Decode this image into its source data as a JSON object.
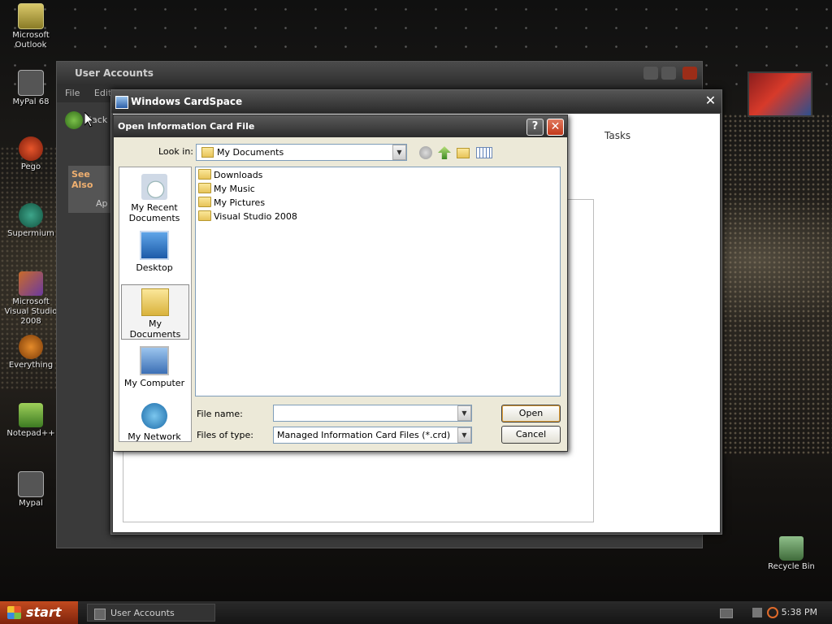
{
  "desktop": {
    "icons": [
      {
        "label": "Microsoft Outlook"
      },
      {
        "label": "MyPal 68"
      },
      {
        "label": "Pego"
      },
      {
        "label": "Supermium"
      },
      {
        "label": "Microsoft Visual Studio 2008"
      },
      {
        "label": "Everything"
      },
      {
        "label": "Notepad++"
      },
      {
        "label": "Mypal"
      },
      {
        "label": "Recycle Bin"
      }
    ]
  },
  "user_accounts_window": {
    "title": "User Accounts",
    "menu": [
      "File",
      "Edit"
    ],
    "back_label": "Back",
    "see_also": "See Also",
    "sidebar_link": "Ap"
  },
  "cardspace_window": {
    "title": "Windows CardSpace",
    "tasks_label": "Tasks"
  },
  "dialog": {
    "title": "Open Information Card File",
    "help_label": "?",
    "look_in_label": "Look in:",
    "look_in_value": "My Documents",
    "places": [
      {
        "label": "My Recent Documents"
      },
      {
        "label": "Desktop"
      },
      {
        "label": "My Documents"
      },
      {
        "label": "My Computer"
      },
      {
        "label": "My Network"
      }
    ],
    "files": [
      {
        "name": "Downloads"
      },
      {
        "name": "My Music"
      },
      {
        "name": "My Pictures"
      },
      {
        "name": "Visual Studio 2008"
      }
    ],
    "file_name_label": "File name:",
    "file_name_value": "",
    "files_of_type_label": "Files of type:",
    "files_of_type_value": "Managed Information Card Files (*.crd)",
    "open_button": "Open",
    "cancel_button": "Cancel"
  },
  "taskbar": {
    "start_label": "start",
    "task_label": "User Accounts",
    "clock": "5:38 PM"
  },
  "colors": {
    "dialog_bg": "#ece9d8",
    "title_bar": "#2c2c2c",
    "close_red": "#c2381a",
    "start_orange": "#c24a1f"
  }
}
